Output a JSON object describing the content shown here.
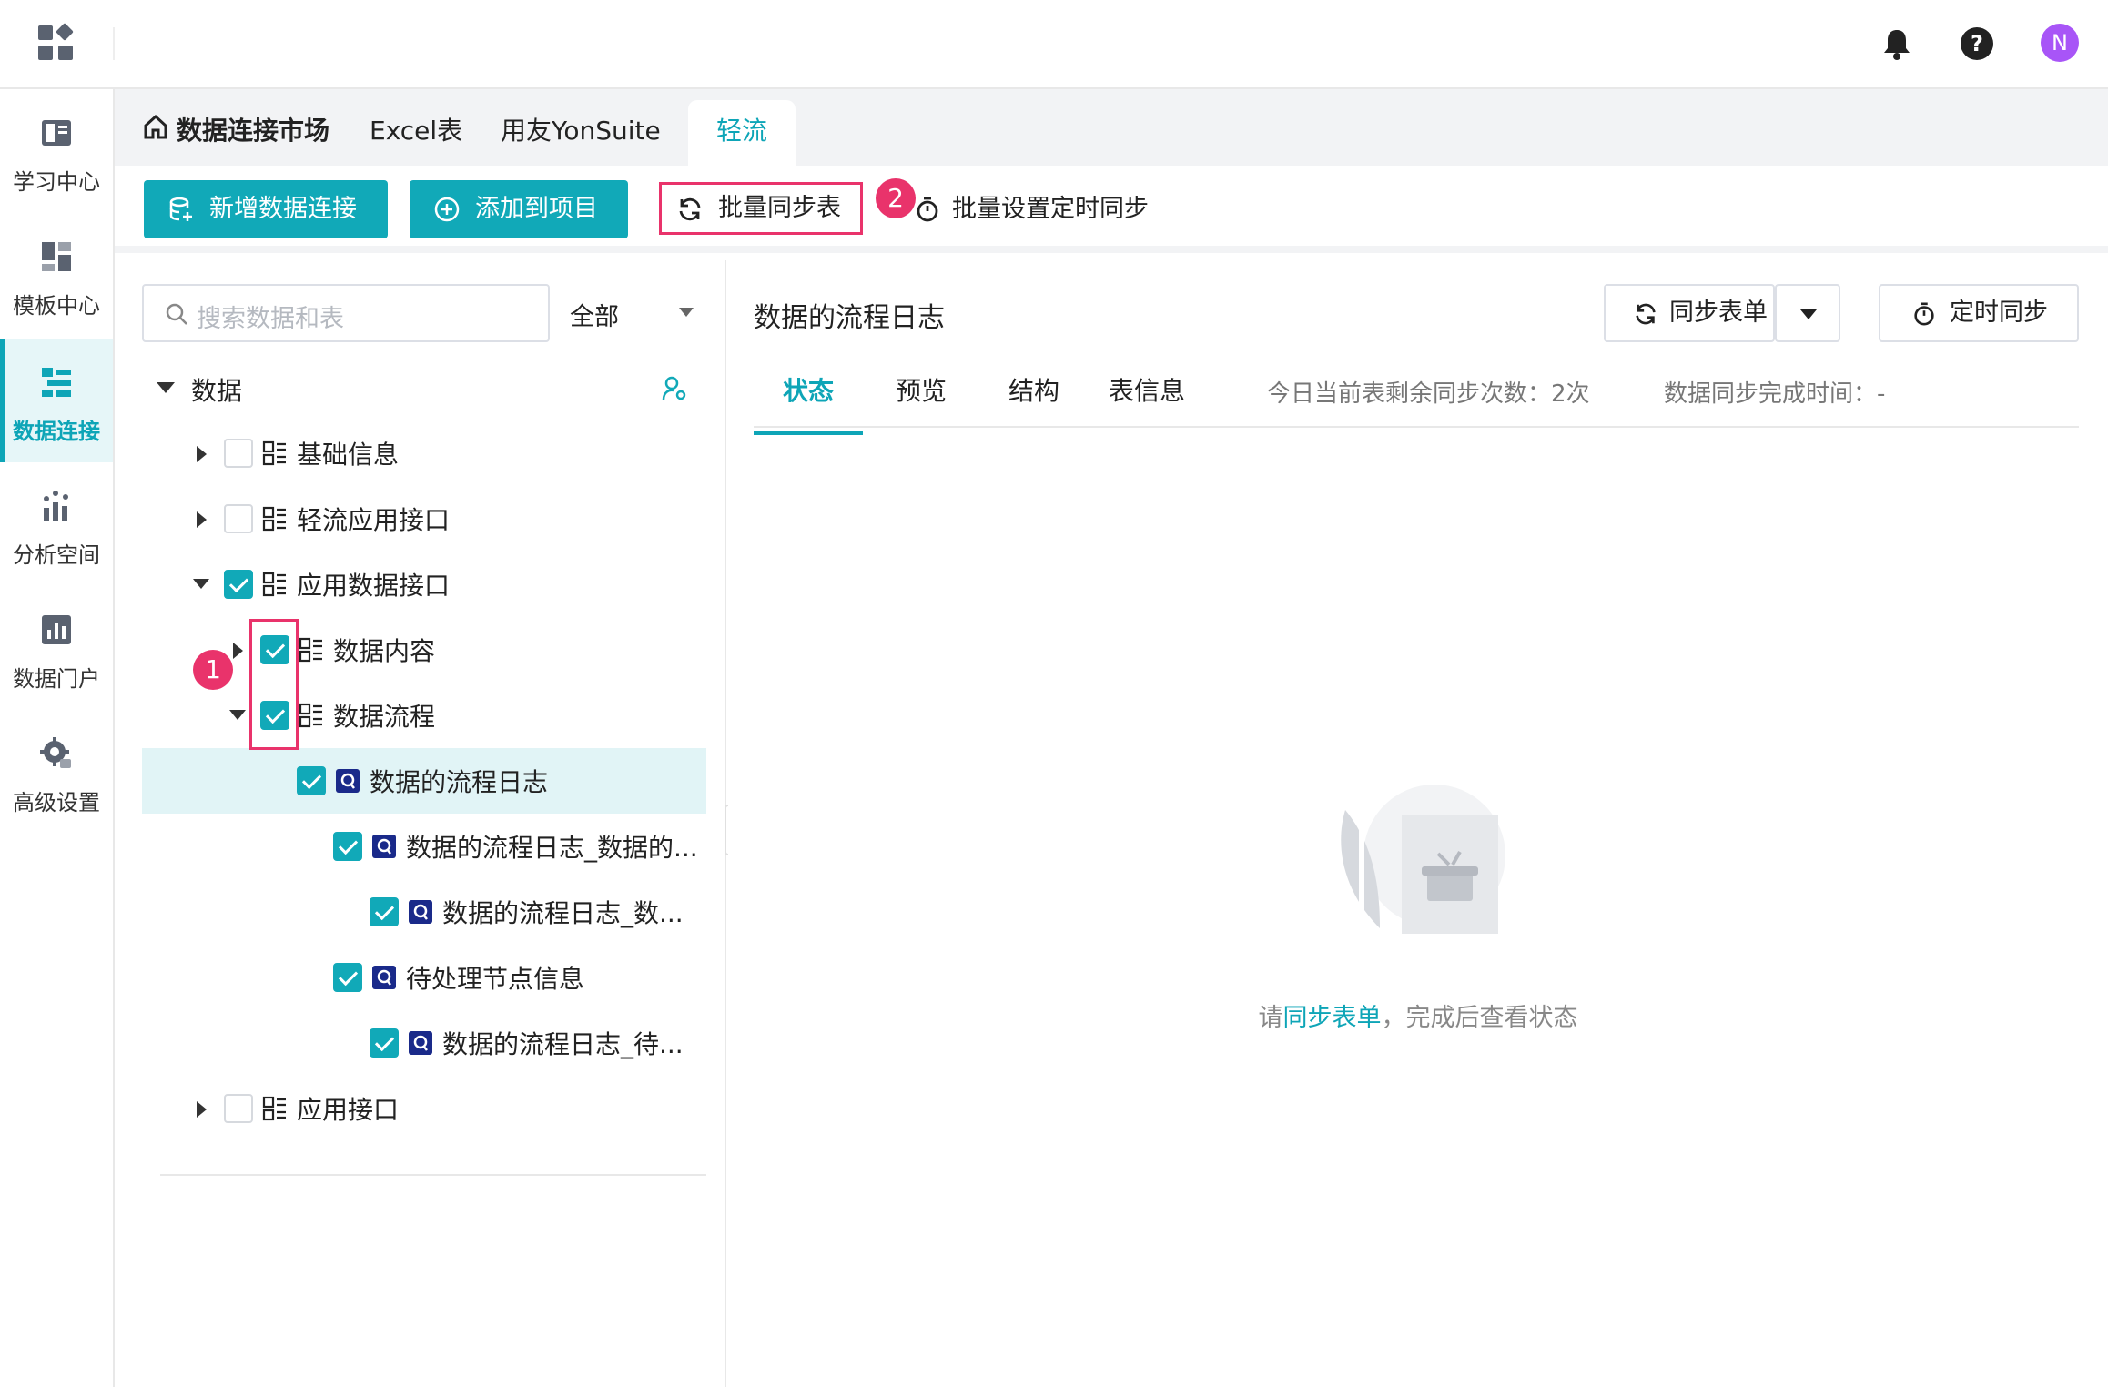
{
  "topbar": {
    "avatar_initial": "N",
    "icons": [
      "app-grid-icon",
      "bell-icon",
      "help-icon"
    ]
  },
  "leftnav": {
    "items": [
      {
        "label": "学习中心",
        "icon": "book-icon",
        "active": false
      },
      {
        "label": "模板中心",
        "icon": "template-icon",
        "active": false
      },
      {
        "label": "数据连接",
        "icon": "data-connect-icon",
        "active": true
      },
      {
        "label": "分析空间",
        "icon": "analysis-icon",
        "active": false
      },
      {
        "label": "数据门户",
        "icon": "portal-icon",
        "active": false
      },
      {
        "label": "高级设置",
        "icon": "gear-icon",
        "active": false
      }
    ]
  },
  "tabs": {
    "home": "数据连接市场",
    "items": [
      "Excel表",
      "用友YonSuite",
      "轻流"
    ],
    "active": "轻流"
  },
  "toolbar": {
    "new_connection": "新增数据连接",
    "add_to_project": "添加到项目",
    "batch_sync": "批量同步表",
    "batch_schedule": "批量设置定时同步",
    "badge_2": "2"
  },
  "tree": {
    "search_placeholder": "搜索数据和表",
    "filter_value": "全部",
    "root_label": "数据",
    "badge_1": "1",
    "nodes": [
      {
        "label": "基础信息",
        "checked": false
      },
      {
        "label": "轻流应用接口",
        "checked": false
      },
      {
        "label": "应用数据接口",
        "checked": true
      },
      {
        "label": "数据内容",
        "checked": true
      },
      {
        "label": "数据流程",
        "checked": true
      },
      {
        "label": "数据的流程日志",
        "checked": true,
        "selected": true
      },
      {
        "label": "数据的流程日志_数据的...",
        "checked": true
      },
      {
        "label": "数据的流程日志_数...",
        "checked": true
      },
      {
        "label": "待处理节点信息",
        "checked": true
      },
      {
        "label": "数据的流程日志_待...",
        "checked": true
      },
      {
        "label": "应用接口",
        "checked": false
      }
    ]
  },
  "detail": {
    "title": "数据的流程日志",
    "sync_button": "同步表单",
    "schedule_button": "定时同步",
    "tabs": [
      "状态",
      "预览",
      "结构",
      "表信息"
    ],
    "active_tab": "状态",
    "remaining_sync": "今日当前表剩余同步次数：2次",
    "sync_done_time": "数据同步完成时间：-",
    "empty_prefix": "请",
    "empty_link": "同步表单",
    "empty_suffix": "，完成后查看状态"
  },
  "colors": {
    "accent": "#11a9b8",
    "highlight": "#e9336b",
    "avatar": "#a855f7"
  }
}
